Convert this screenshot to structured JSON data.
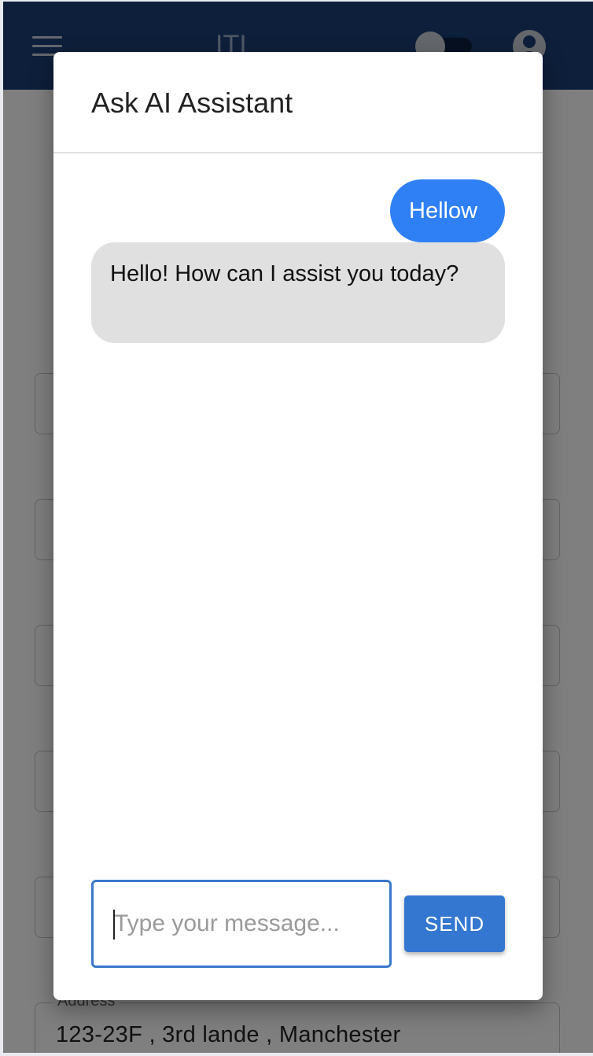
{
  "appbar": {
    "title": "ITI",
    "menu_icon": "menu-icon",
    "theme_toggle_icon": "toggle-icon",
    "account_icon": "account-circle-icon",
    "color": "#1d3e76"
  },
  "form": {
    "address_label": "Address",
    "address_value": "123-23F , 3rd lande , Manchester"
  },
  "dialog": {
    "title": "Ask AI Assistant",
    "messages": [
      {
        "role": "user",
        "text": "Hellow"
      },
      {
        "role": "assistant",
        "text": "Hello! How can I assist you today?"
      }
    ],
    "input": {
      "value": "",
      "placeholder": "Type your message..."
    },
    "send_label": "SEND",
    "colors": {
      "user_bubble": "#3080f5",
      "assistant_bubble": "#e0e0e0",
      "send_button": "#3477d1"
    }
  }
}
